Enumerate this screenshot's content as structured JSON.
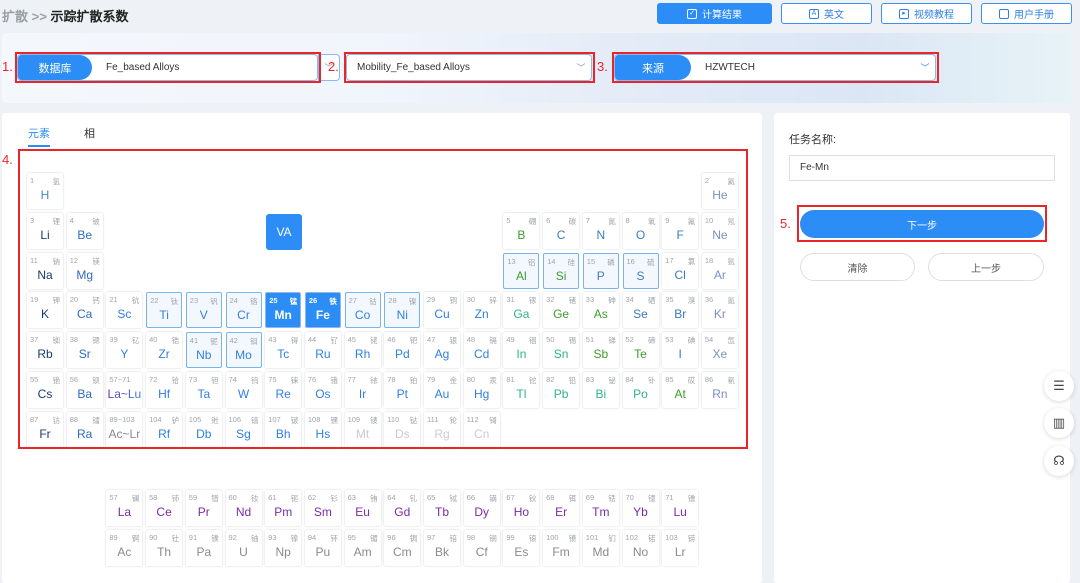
{
  "breadcrumb": {
    "parent": "扩散",
    "sep": ">>",
    "current": "示踪扩散系数"
  },
  "toolbar": {
    "results": "计算结果",
    "english": "英文",
    "video": "视频教程",
    "manual": "用户手册"
  },
  "filters": {
    "database": {
      "label": "数据库",
      "value": "Fe_based Alloys"
    },
    "mobility": {
      "value": "Mobility_Fe_based Alloys"
    },
    "source": {
      "label": "来源",
      "value": "HZWTECH"
    }
  },
  "annotations": [
    "1.",
    "2.",
    "3.",
    "4.",
    "5."
  ],
  "tabs": [
    {
      "label": "元素",
      "active": true
    },
    {
      "label": "相",
      "active": false
    }
  ],
  "group_button": "VA",
  "colors": {
    "accent": "#2b8df5",
    "annotation": "#e8262a",
    "categories": {
      "h": "#4a8ac8",
      "a": "#1d3a70",
      "e": "#2e6bc0",
      "t": "#2f80e0",
      "p": "#2fb38a",
      "m": "#3a9e2a",
      "n": "#3b7bbf",
      "g": "#7d8fc4",
      "l": "#7a2aa8",
      "c": "#8a8a8a",
      "x": "#7a2aa8",
      "y": "#8a8a8a"
    }
  },
  "elements": [
    [
      1,
      "H",
      "氢",
      "h",
      ""
    ],
    [
      2,
      "He",
      "氦",
      "g",
      ""
    ],
    [
      3,
      "Li",
      "锂",
      "a",
      ""
    ],
    [
      4,
      "Be",
      "铍",
      "e",
      ""
    ],
    [
      5,
      "B",
      "硼",
      "m",
      ""
    ],
    [
      6,
      "C",
      "碳",
      "n",
      ""
    ],
    [
      7,
      "N",
      "氮",
      "n",
      ""
    ],
    [
      8,
      "O",
      "氧",
      "n",
      ""
    ],
    [
      9,
      "F",
      "氟",
      "n",
      ""
    ],
    [
      10,
      "Ne",
      "氖",
      "g",
      ""
    ],
    [
      11,
      "Na",
      "钠",
      "a",
      ""
    ],
    [
      12,
      "Mg",
      "镁",
      "e",
      ""
    ],
    [
      13,
      "Al",
      "铝",
      "m",
      "avail"
    ],
    [
      14,
      "Si",
      "硅",
      "m",
      "avail"
    ],
    [
      15,
      "P",
      "磷",
      "n",
      "avail"
    ],
    [
      16,
      "S",
      "硫",
      "n",
      "avail"
    ],
    [
      17,
      "Cl",
      "氯",
      "n",
      ""
    ],
    [
      18,
      "Ar",
      "氩",
      "g",
      ""
    ],
    [
      19,
      "K",
      "钾",
      "a",
      ""
    ],
    [
      20,
      "Ca",
      "钙",
      "e",
      ""
    ],
    [
      21,
      "Sc",
      "钪",
      "t",
      ""
    ],
    [
      22,
      "Ti",
      "钛",
      "t",
      "avail"
    ],
    [
      23,
      "V",
      "钒",
      "t",
      "avail"
    ],
    [
      24,
      "Cr",
      "铬",
      "t",
      "avail"
    ],
    [
      25,
      "Mn",
      "锰",
      "t",
      "sel"
    ],
    [
      26,
      "Fe",
      "铁",
      "t",
      "sel"
    ],
    [
      27,
      "Co",
      "钴",
      "t",
      "avail"
    ],
    [
      28,
      "Ni",
      "镍",
      "t",
      "avail"
    ],
    [
      29,
      "Cu",
      "铜",
      "t",
      ""
    ],
    [
      30,
      "Zn",
      "锌",
      "t",
      ""
    ],
    [
      31,
      "Ga",
      "镓",
      "p",
      ""
    ],
    [
      32,
      "Ge",
      "锗",
      "m",
      ""
    ],
    [
      33,
      "As",
      "砷",
      "m",
      ""
    ],
    [
      34,
      "Se",
      "硒",
      "n",
      ""
    ],
    [
      35,
      "Br",
      "溴",
      "n",
      ""
    ],
    [
      36,
      "Kr",
      "氪",
      "g",
      ""
    ],
    [
      37,
      "Rb",
      "铷",
      "a",
      ""
    ],
    [
      38,
      "Sr",
      "锶",
      "e",
      ""
    ],
    [
      39,
      "Y",
      "钇",
      "t",
      ""
    ],
    [
      40,
      "Zr",
      "锆",
      "t",
      ""
    ],
    [
      41,
      "Nb",
      "铌",
      "t",
      "avail"
    ],
    [
      42,
      "Mo",
      "钼",
      "t",
      "avail"
    ],
    [
      43,
      "Tc",
      "锝",
      "t",
      ""
    ],
    [
      44,
      "Ru",
      "钌",
      "t",
      ""
    ],
    [
      45,
      "Rh",
      "铑",
      "t",
      ""
    ],
    [
      46,
      "Pd",
      "钯",
      "t",
      ""
    ],
    [
      47,
      "Ag",
      "银",
      "t",
      ""
    ],
    [
      48,
      "Cd",
      "镉",
      "t",
      ""
    ],
    [
      49,
      "In",
      "铟",
      "p",
      ""
    ],
    [
      50,
      "Sn",
      "锡",
      "p",
      ""
    ],
    [
      51,
      "Sb",
      "锑",
      "m",
      ""
    ],
    [
      52,
      "Te",
      "碲",
      "m",
      ""
    ],
    [
      53,
      "I",
      "碘",
      "n",
      ""
    ],
    [
      54,
      "Xe",
      "氙",
      "g",
      ""
    ],
    [
      55,
      "Cs",
      "铯",
      "a",
      ""
    ],
    [
      56,
      "Ba",
      "钡",
      "e",
      ""
    ],
    [
      "57~71",
      "La~Lu",
      "",
      "x",
      ""
    ],
    [
      72,
      "Hf",
      "铪",
      "t",
      ""
    ],
    [
      73,
      "Ta",
      "钽",
      "t",
      ""
    ],
    [
      74,
      "W",
      "钨",
      "t",
      ""
    ],
    [
      75,
      "Re",
      "铼",
      "t",
      ""
    ],
    [
      76,
      "Os",
      "锇",
      "t",
      ""
    ],
    [
      77,
      "Ir",
      "铱",
      "t",
      ""
    ],
    [
      78,
      "Pt",
      "铂",
      "t",
      ""
    ],
    [
      79,
      "Au",
      "金",
      "t",
      ""
    ],
    [
      80,
      "Hg",
      "汞",
      "t",
      ""
    ],
    [
      81,
      "Tl",
      "铊",
      "p",
      ""
    ],
    [
      82,
      "Pb",
      "铅",
      "p",
      ""
    ],
    [
      83,
      "Bi",
      "铋",
      "p",
      ""
    ],
    [
      84,
      "Po",
      "钋",
      "p",
      ""
    ],
    [
      85,
      "At",
      "砹",
      "m",
      ""
    ],
    [
      86,
      "Rn",
      "氡",
      "g",
      ""
    ],
    [
      87,
      "Fr",
      "钫",
      "a",
      ""
    ],
    [
      88,
      "Ra",
      "镭",
      "e",
      ""
    ],
    [
      "89~103",
      "Ac~Lr",
      "",
      "y",
      ""
    ],
    [
      104,
      "Rf",
      "𬬻",
      "t",
      ""
    ],
    [
      105,
      "Db",
      "𬭊",
      "t",
      ""
    ],
    [
      106,
      "Sg",
      "𬭳",
      "t",
      ""
    ],
    [
      107,
      "Bh",
      "𬭛",
      "t",
      ""
    ],
    [
      108,
      "Hs",
      "𬭶",
      "t",
      ""
    ],
    [
      109,
      "Mt",
      "鿏",
      "t",
      "dis"
    ],
    [
      110,
      "Ds",
      "𫟼",
      "t",
      "dis"
    ],
    [
      111,
      "Rg",
      "𬬭",
      "t",
      "dis"
    ],
    [
      112,
      "Cn",
      "鿔",
      "t",
      "dis"
    ],
    [
      57,
      "La",
      "镧",
      "l",
      ""
    ],
    [
      58,
      "Ce",
      "铈",
      "l",
      ""
    ],
    [
      59,
      "Pr",
      "镨",
      "l",
      ""
    ],
    [
      60,
      "Nd",
      "钕",
      "l",
      ""
    ],
    [
      61,
      "Pm",
      "钷",
      "l",
      ""
    ],
    [
      62,
      "Sm",
      "钐",
      "l",
      ""
    ],
    [
      63,
      "Eu",
      "铕",
      "l",
      ""
    ],
    [
      64,
      "Gd",
      "钆",
      "l",
      ""
    ],
    [
      65,
      "Tb",
      "铽",
      "l",
      ""
    ],
    [
      66,
      "Dy",
      "镝",
      "l",
      ""
    ],
    [
      67,
      "Ho",
      "钬",
      "l",
      ""
    ],
    [
      68,
      "Er",
      "铒",
      "l",
      ""
    ],
    [
      69,
      "Tm",
      "铥",
      "l",
      ""
    ],
    [
      70,
      "Yb",
      "镱",
      "l",
      ""
    ],
    [
      71,
      "Lu",
      "镥",
      "l",
      ""
    ],
    [
      89,
      "Ac",
      "锕",
      "c",
      ""
    ],
    [
      90,
      "Th",
      "钍",
      "c",
      ""
    ],
    [
      91,
      "Pa",
      "镤",
      "c",
      ""
    ],
    [
      92,
      "U",
      "铀",
      "c",
      ""
    ],
    [
      93,
      "Np",
      "镎",
      "c",
      ""
    ],
    [
      94,
      "Pu",
      "钚",
      "c",
      ""
    ],
    [
      95,
      "Am",
      "镅",
      "c",
      ""
    ],
    [
      96,
      "Cm",
      "锔",
      "c",
      ""
    ],
    [
      97,
      "Bk",
      "锫",
      "c",
      ""
    ],
    [
      98,
      "Cf",
      "锎",
      "c",
      ""
    ],
    [
      99,
      "Es",
      "锿",
      "c",
      ""
    ],
    [
      100,
      "Fm",
      "镄",
      "c",
      ""
    ],
    [
      101,
      "Md",
      "钔",
      "c",
      ""
    ],
    [
      102,
      "No",
      "锘",
      "c",
      ""
    ],
    [
      103,
      "Lr",
      "铹",
      "c",
      ""
    ]
  ],
  "task": {
    "label": "任务名称:",
    "value": "Fe-Mn"
  },
  "actions": {
    "next": "下一步",
    "clear": "清除",
    "prev": "上一步"
  }
}
